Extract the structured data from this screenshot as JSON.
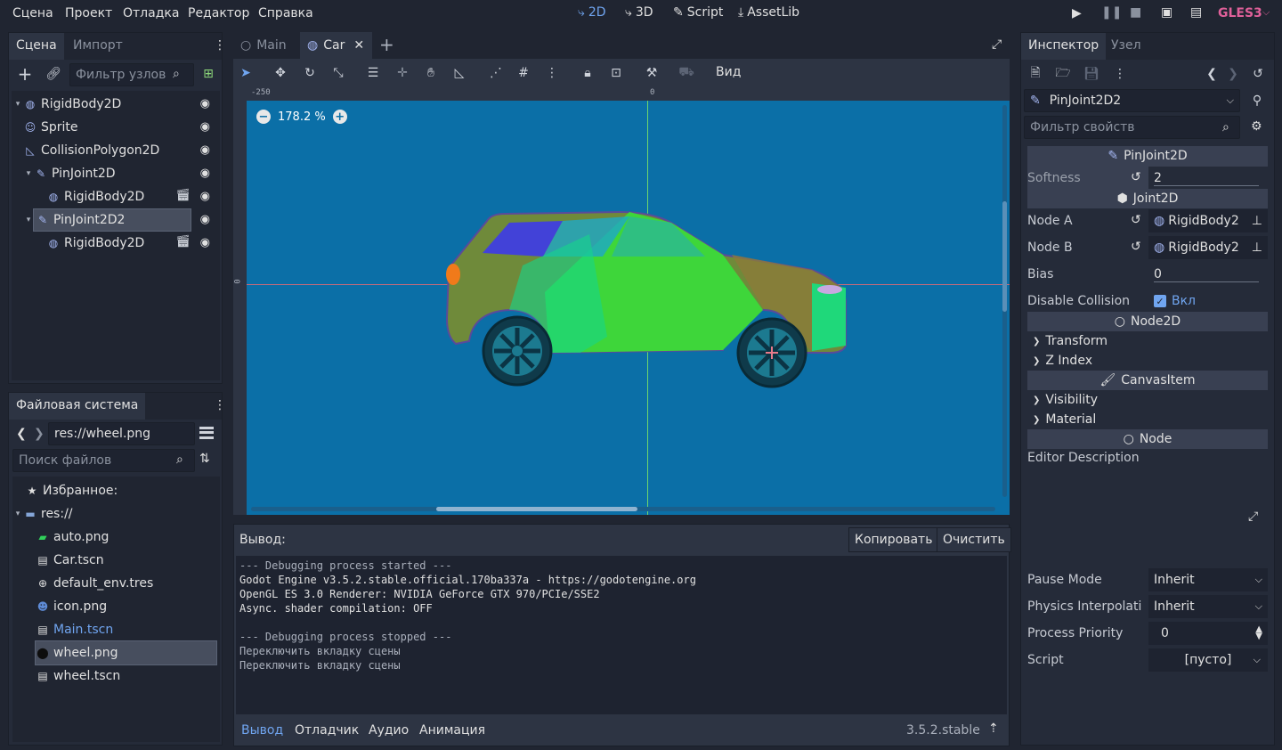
{
  "menubar": {
    "items": [
      "Сцена",
      "Проект",
      "Отладка",
      "Редактор",
      "Справка"
    ],
    "modes": [
      {
        "label": "2D",
        "icon": "2d-icon",
        "active": true
      },
      {
        "label": "3D",
        "icon": "3d-icon",
        "active": false
      },
      {
        "label": "Script",
        "icon": "script-icon",
        "active": false
      },
      {
        "label": "AssetLib",
        "icon": "assetlib-icon",
        "active": false
      }
    ],
    "renderer": "GLES3"
  },
  "scene_dock": {
    "tabs": [
      "Сцена",
      "Импорт"
    ],
    "filter_placeholder": "Фильтр узлов",
    "nodes": [
      {
        "label": "RigidBody2D",
        "icon": "rigidbody-icon",
        "depth": 0
      },
      {
        "label": "Sprite",
        "icon": "sprite-icon",
        "depth": 1
      },
      {
        "label": "CollisionPolygon2D",
        "icon": "collision-polygon-icon",
        "depth": 1
      },
      {
        "label": "PinJoint2D",
        "icon": "pinjoint-icon",
        "depth": 1
      },
      {
        "label": "RigidBody2D",
        "icon": "rigidbody-icon",
        "depth": 2
      },
      {
        "label": "PinJoint2D2",
        "icon": "pinjoint-icon",
        "depth": 1,
        "selected": true
      },
      {
        "label": "RigidBody2D",
        "icon": "rigidbody-icon",
        "depth": 2
      }
    ]
  },
  "filesystem_dock": {
    "tab": "Файловая система",
    "path": "res://wheel.png",
    "search_placeholder": "Поиск файлов",
    "favorites": "Избранное:",
    "root": "res://",
    "files": [
      {
        "label": "auto.png",
        "icon": "image-icon"
      },
      {
        "label": "Car.tscn",
        "icon": "scene-icon"
      },
      {
        "label": "default_env.tres",
        "icon": "environment-icon"
      },
      {
        "label": "icon.png",
        "icon": "image-icon"
      },
      {
        "label": "Main.tscn",
        "icon": "scene-icon",
        "highlight": true
      },
      {
        "label": "wheel.png",
        "icon": "image-icon",
        "selected": true
      },
      {
        "label": "wheel.tscn",
        "icon": "scene-icon"
      }
    ]
  },
  "editor_tabs": {
    "tabs": [
      {
        "label": "Main"
      },
      {
        "label": "Car",
        "active": true
      }
    ]
  },
  "toolbar": {
    "view_label": "Вид"
  },
  "viewport": {
    "zoom": "178.2 %",
    "ruler_h_labels": [
      "-250",
      "0"
    ],
    "ruler_v_label": "0",
    "bg_color": "#0b6fa7"
  },
  "output": {
    "title": "Вывод:",
    "copy_label": "Копировать",
    "clear_label": "Очистить",
    "lines": [
      "--- Debugging process started ---",
      "Godot Engine v3.5.2.stable.official.170ba337a - https://godotengine.org",
      "OpenGL ES 3.0 Renderer: NVIDIA GeForce GTX 970/PCIe/SSE2",
      "Async. shader compilation: OFF",
      "",
      "--- Debugging process stopped ---",
      "Переключить вкладку сцены",
      "Переключить вкладку сцены"
    ],
    "bottom_tabs": [
      "Вывод",
      "Отладчик",
      "Аудио",
      "Анимация"
    ],
    "version": "3.5.2.stable"
  },
  "inspector": {
    "tabs": [
      "Инспектор",
      "Узел"
    ],
    "node_name": "PinJoint2D2",
    "filter_placeholder": "Фильтр свойств",
    "sections": {
      "pinjoint": "PinJoint2D",
      "joint": "Joint2D",
      "node2d": "Node2D",
      "canvasitem": "CanvasItem",
      "node": "Node"
    },
    "softness": {
      "label": "Softness",
      "value": "2"
    },
    "node_a": {
      "label": "Node A",
      "value": "RigidBody2"
    },
    "node_b": {
      "label": "Node B",
      "value": "RigidBody2"
    },
    "bias": {
      "label": "Bias",
      "value": "0"
    },
    "disable_collision": {
      "label": "Disable Collision",
      "value": "Вкл"
    },
    "transform": "Transform",
    "z_index": "Z Index",
    "visibility": "Visibility",
    "material": "Material",
    "editor_description": "Editor Description",
    "pause_mode": {
      "label": "Pause Mode",
      "value": "Inherit"
    },
    "physics_interp": {
      "label": "Physics Interpolati",
      "value": "Inherit"
    },
    "process_priority": {
      "label": "Process Priority",
      "value": "0"
    },
    "script": {
      "label": "Script",
      "value": "[пусто]"
    }
  }
}
